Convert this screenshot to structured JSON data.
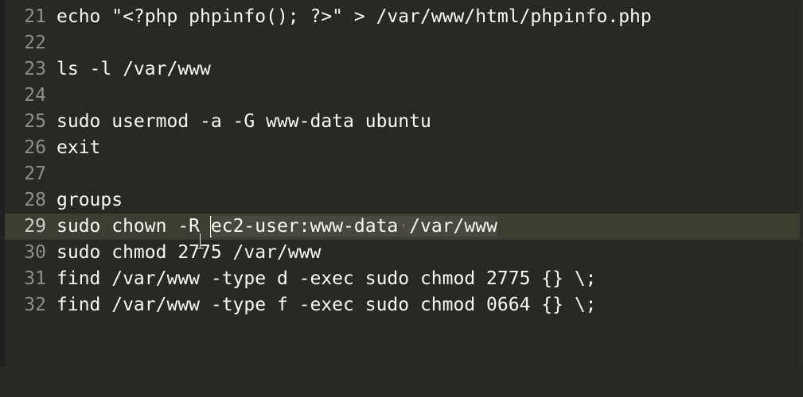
{
  "editor": {
    "current_line": "29",
    "lines": [
      {
        "number": "21",
        "text": "echo \"<?php phpinfo(); ?>\" > /var/www/html/phpinfo.php"
      },
      {
        "number": "22",
        "text": ""
      },
      {
        "number": "23",
        "text": "ls -l /var/www"
      },
      {
        "number": "24",
        "text": ""
      },
      {
        "number": "25",
        "text": "sudo usermod -a -G www-data ubuntu"
      },
      {
        "number": "26",
        "text": "exit"
      },
      {
        "number": "27",
        "text": ""
      },
      {
        "number": "28",
        "text": "groups"
      },
      {
        "number": "29",
        "text_before": "sudo chown -R ",
        "selected_part1": "ec2-user:www-data",
        "whitespace_marker": "·",
        "selected_part2": "/var/www"
      },
      {
        "number": "30",
        "text": "sudo chmod 2775 /var/www"
      },
      {
        "number": "31",
        "text": "find /var/www -type d -exec sudo chmod 2775 {} \\;"
      },
      {
        "number": "32",
        "text": "find /var/www -type f -exec sudo chmod 0664 {} \\;"
      }
    ]
  },
  "colors": {
    "background": "#282923",
    "current_line": "#3e3d32",
    "selection": "#49483e",
    "text": "#f8f8f2",
    "gutter_text": "#8f908a"
  }
}
